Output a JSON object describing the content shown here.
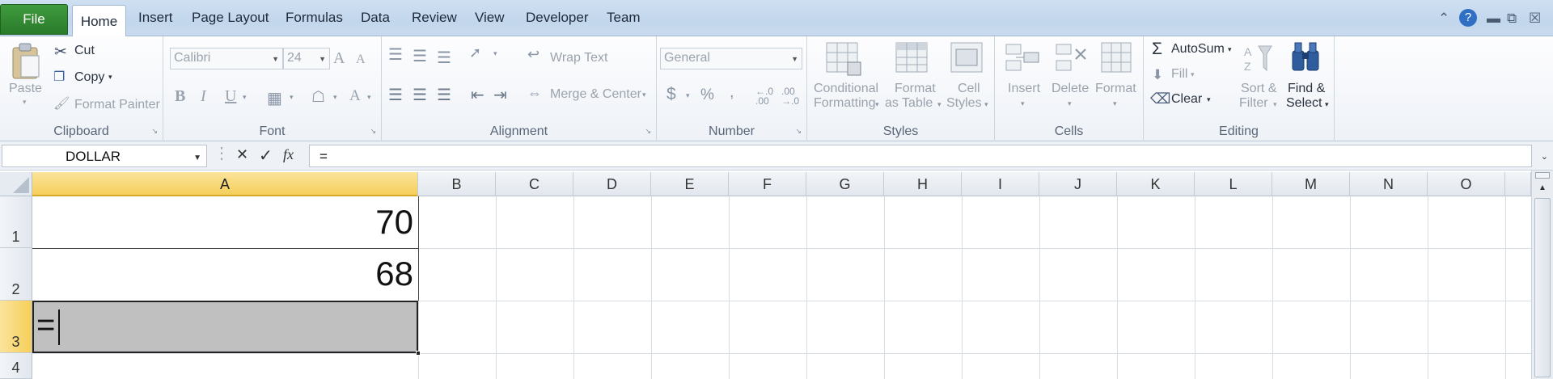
{
  "tabs": {
    "file": "File",
    "items": [
      "Home",
      "Insert",
      "Page Layout",
      "Formulas",
      "Data",
      "Review",
      "View",
      "Developer",
      "Team"
    ]
  },
  "ribbon": {
    "clipboard": {
      "paste": "Paste",
      "cut": "Cut",
      "copy": "Copy",
      "format_painter": "Format Painter",
      "label": "Clipboard"
    },
    "font": {
      "font_name": "Calibri",
      "font_size": "24",
      "grow": "A",
      "shrink": "A",
      "bold": "B",
      "italic": "I",
      "underline": "U",
      "font_color": "A",
      "label": "Font"
    },
    "alignment": {
      "wrap_text": "Wrap Text",
      "merge_center": "Merge & Center",
      "label": "Alignment"
    },
    "number": {
      "format": "General",
      "currency": "$",
      "percent": "%",
      "comma": ",",
      "inc_decimal": "←.0 .00",
      "dec_decimal": ".00 →.0",
      "label": "Number"
    },
    "styles": {
      "conditional_1": "Conditional",
      "conditional_2": "Formatting",
      "format_table_1": "Format",
      "format_table_2": "as Table",
      "cell_styles_1": "Cell",
      "cell_styles_2": "Styles",
      "label": "Styles"
    },
    "cells": {
      "insert": "Insert",
      "delete": "Delete",
      "format": "Format",
      "label": "Cells"
    },
    "editing": {
      "autosum": "AutoSum",
      "fill": "Fill",
      "clear": "Clear",
      "sort_1": "Sort &",
      "sort_2": "Filter",
      "find_1": "Find &",
      "find_2": "Select",
      "label": "Editing"
    }
  },
  "formula_bar": {
    "name_box": "DOLLAR",
    "cancel": "✕",
    "enter": "✓",
    "fx": "fx",
    "content": "="
  },
  "grid": {
    "columns": [
      "A",
      "B",
      "C",
      "D",
      "E",
      "F",
      "G",
      "H",
      "I",
      "J",
      "K",
      "L",
      "M",
      "N",
      "O"
    ],
    "rows": [
      "1",
      "2",
      "3",
      "4"
    ],
    "cells": {
      "A1": "70",
      "A2": "68",
      "A3": "="
    }
  },
  "colors": {
    "file_tab": "#2a7b2a",
    "selected_header": "#f5cf5a",
    "active_cell_fill": "#c0c0c0"
  }
}
